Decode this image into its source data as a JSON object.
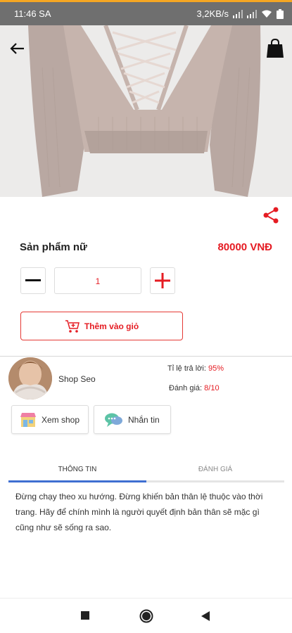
{
  "status_bar": {
    "time": "11:46 SA",
    "network_speed": "3,2KB/s"
  },
  "colors": {
    "accent": "#e51c23",
    "tab_indicator": "#3f6fd1",
    "status_bar": "#6f6f6f"
  },
  "product": {
    "name": "Sản phẩm nữ",
    "price": "80000 VNĐ",
    "quantity": "1"
  },
  "actions": {
    "add_to_cart": "Thêm vào giỏ"
  },
  "shop": {
    "name": "Shop Seo",
    "reply_rate_label": "Tỉ lệ trả lời: ",
    "reply_rate_value": "95%",
    "rating_label": "Đánh giá: ",
    "rating_value": "8/10",
    "view_shop": "Xem shop",
    "message": "Nhắn tin"
  },
  "tabs": [
    {
      "label": "THÔNG TIN",
      "active": true
    },
    {
      "label": "ĐÁNH GIÁ",
      "active": false
    }
  ],
  "description": "Đừng chạy theo xu hướng. Đừng khiến bản thân lệ thuộc vào thời trang. Hãy để chính mình là người quyết định bản thân sẽ mặc gì cũng như sẽ sống ra sao.",
  "icons": [
    "back-arrow-icon",
    "shopping-bag-icon",
    "share-icon",
    "minus-icon",
    "plus-icon",
    "cart-add-icon",
    "store-icon",
    "chat-icon",
    "square-nav-icon",
    "circle-nav-icon",
    "triangle-nav-icon"
  ]
}
